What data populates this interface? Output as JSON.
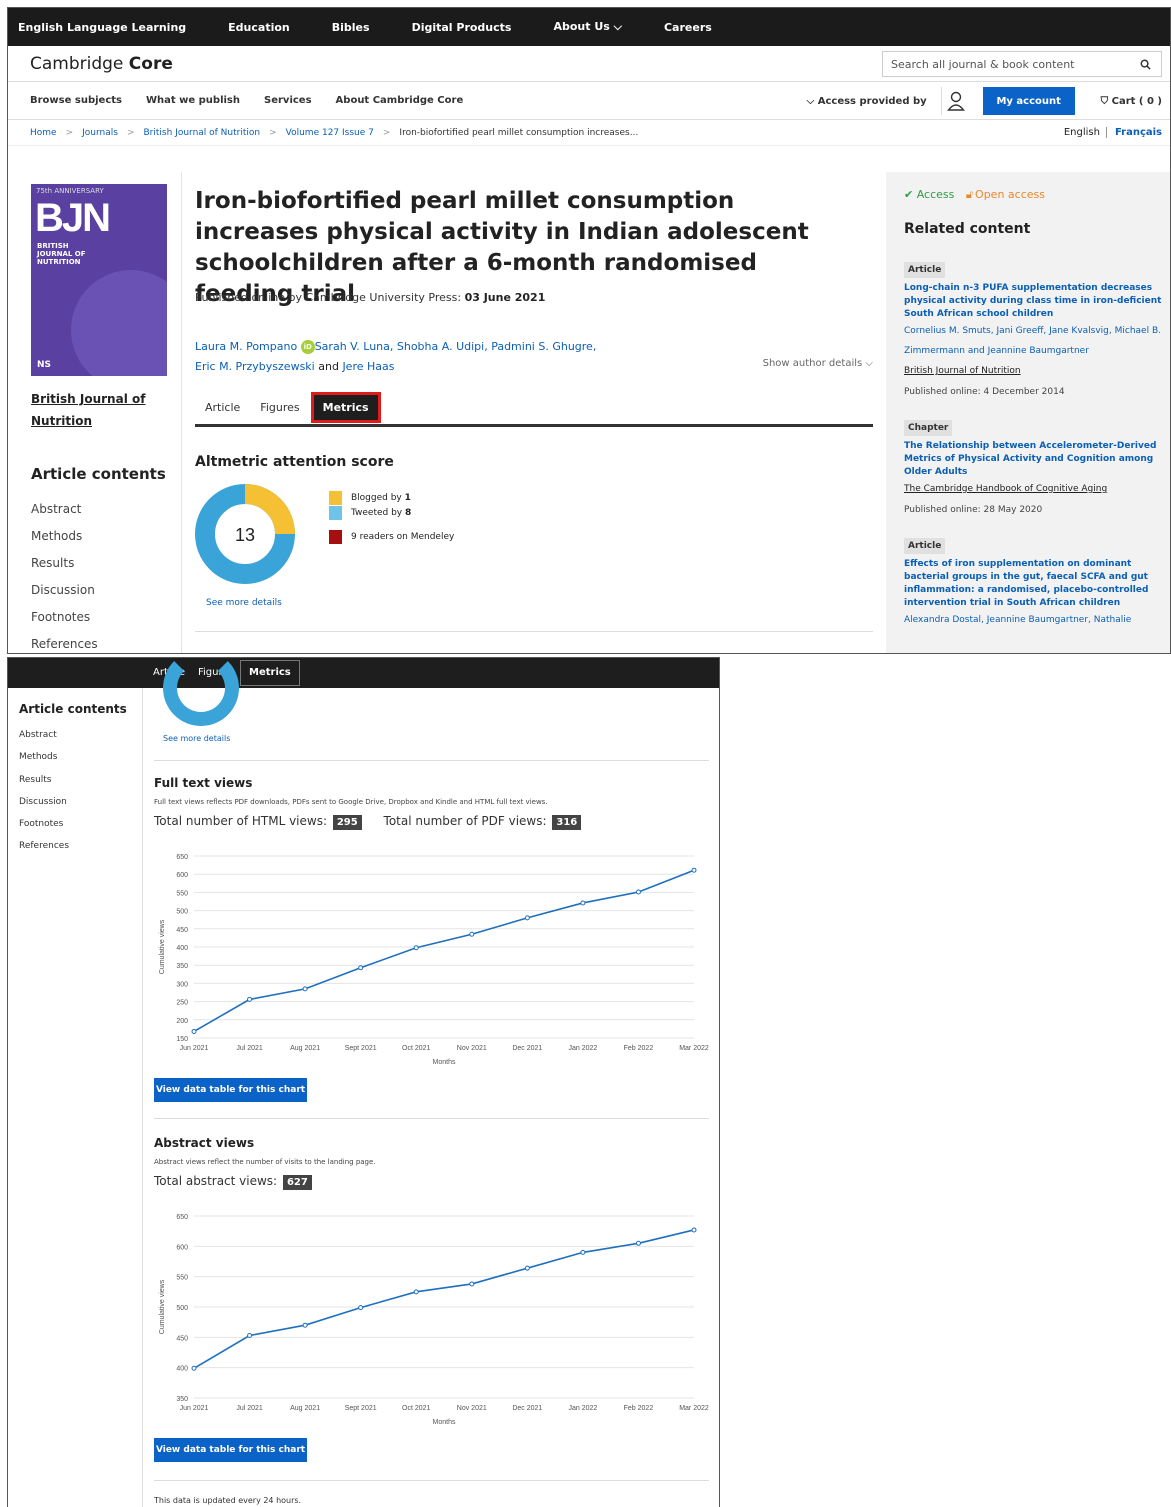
{
  "topbar": [
    "English Language Learning",
    "Education",
    "Bibles",
    "Digital Products",
    "About Us ⌵",
    "Careers"
  ],
  "brand": {
    "plain": "Cambridge ",
    "bold": "Core"
  },
  "search": {
    "placeholder": "Search all journal & book content"
  },
  "nav": {
    "links": [
      "Browse subjects",
      "What we publish",
      "Services",
      "About Cambridge Core"
    ],
    "access": "⌵  Access provided by",
    "my_account": "My account",
    "cart": "Cart ( 0 )"
  },
  "breadcrumb": {
    "items": [
      "Home",
      "Journals",
      "British Journal of Nutrition",
      "Volume 127 Issue 7"
    ],
    "current": "Iron-biofortified pearl millet consumption increases..."
  },
  "lang": {
    "en": "English",
    "fr": "Français"
  },
  "cover": {
    "anniversary": "75th ANNIVERSARY",
    "acronym": "BJN",
    "subtitle": "BRITISH JOURNAL OF NUTRITION",
    "ns": "NS"
  },
  "journal_link": "British Journal of Nutrition",
  "contents": {
    "title": "Article contents",
    "items": [
      "Abstract",
      "Methods",
      "Results",
      "Discussion",
      "Footnotes",
      "References"
    ]
  },
  "article": {
    "title": "Iron-biofortified pearl millet consumption increases physical activity in Indian adolescent schoolchildren after a 6-month randomised feeding trial",
    "pub_prefix": "Published online by Cambridge University Press:",
    "pub_date": "03 June 2021",
    "authors": {
      "a1": "Laura M. Pompano",
      "a2": "Sarah V. Luna, Shobha A. Udipi, Padmini S. Ghugre,",
      "a3": "Eric M. Przybyszewski",
      "and": "and",
      "a4": "Jere Haas"
    },
    "show_author": "Show author details ⌵",
    "tabs": [
      "Article",
      "Figures",
      "Metrics"
    ]
  },
  "altmetric": {
    "title": "Altmetric attention score",
    "score": "13",
    "blogged_prefix": "Blogged by",
    "blogged": "1",
    "tweeted_prefix": "Tweeted by",
    "tweeted": "8",
    "mendeley": "9 readers on Mendeley",
    "see_more": "See more details",
    "colors": {
      "blog": "#f5c033",
      "twitter": "#6ec3e8",
      "mendeley": "#a50f0f",
      "ring": "#3aa3d8"
    }
  },
  "sidebar": {
    "access": "Access",
    "open_access": "Open access",
    "related_title": "Related content",
    "items": [
      {
        "type": "Article",
        "title": "Long-chain n-3 PUFA supplementation decreases physical activity during class time in iron-deficient South African school children",
        "authors": "Cornelius M. Smuts, Jani Greeff, Jane Kvalsvig, Michael B. Zimmermann and Jeannine Baumgartner",
        "source": "British Journal of Nutrition",
        "published": "Published online: 4 December 2014"
      },
      {
        "type": "Chapter",
        "title": "The Relationship between Accelerometer-Derived Metrics of Physical Activity and Cognition among Older Adults",
        "authors": "",
        "source": "The Cambridge Handbook of Cognitive Aging",
        "published": "Published online: 28 May 2020"
      },
      {
        "type": "Article",
        "title": "Effects of iron supplementation on dominant bacterial groups in the gut, faecal SCFA and gut inflammation: a randomised, placebo-controlled intervention trial in South African children",
        "authors": "Alexandra Dostal, Jeannine Baumgartner, Nathalie",
        "source": "",
        "published": ""
      }
    ]
  },
  "metrics": {
    "full_text": {
      "title": "Full text views",
      "desc": "Full text views reflects PDF downloads, PDFs sent to Google Drive, Dropbox and Kindle and HTML full text views.",
      "html_label": "Total number of HTML views:",
      "html_value": "295",
      "pdf_label": "Total number of PDF views:",
      "pdf_value": "316",
      "button": "View data table for this chart"
    },
    "abstract": {
      "title": "Abstract views",
      "desc": "Abstract views reflect the number of visits to the landing page.",
      "total_label": "Total abstract views:",
      "total_value": "627",
      "button": "View data table for this chart"
    },
    "footnote": "This data is updated every 24 hours."
  },
  "chart_data": [
    {
      "type": "line",
      "title": "",
      "xlabel": "Months",
      "ylabel": "Cumulative views",
      "categories": [
        "Jun 2021",
        "Jul 2021",
        "Aug 2021",
        "Sept 2021",
        "Oct 2021",
        "Nov 2021",
        "Dec 2021",
        "Jan 2022",
        "Feb 2022",
        "Mar 2022"
      ],
      "values": [
        168,
        256,
        285,
        343,
        398,
        435,
        480,
        521,
        551,
        611
      ],
      "ylim": [
        150,
        650
      ],
      "yticks": [
        150,
        200,
        250,
        300,
        350,
        400,
        450,
        500,
        550,
        600,
        650
      ],
      "grid": true,
      "color": "#1f6fbf"
    },
    {
      "type": "line",
      "title": "",
      "xlabel": "Months",
      "ylabel": "Cumulative views",
      "categories": [
        "Jun 2021",
        "Jul 2021",
        "Aug 2021",
        "Sept 2021",
        "Oct 2021",
        "Nov 2021",
        "Dec 2021",
        "Jan 2022",
        "Feb 2022",
        "Mar 2022"
      ],
      "values": [
        399,
        453,
        470,
        499,
        525,
        538,
        564,
        590,
        605,
        627
      ],
      "ylim": [
        350,
        650
      ],
      "yticks": [
        350,
        400,
        450,
        500,
        550,
        600,
        650
      ],
      "grid": true,
      "color": "#1f6fbf"
    }
  ]
}
